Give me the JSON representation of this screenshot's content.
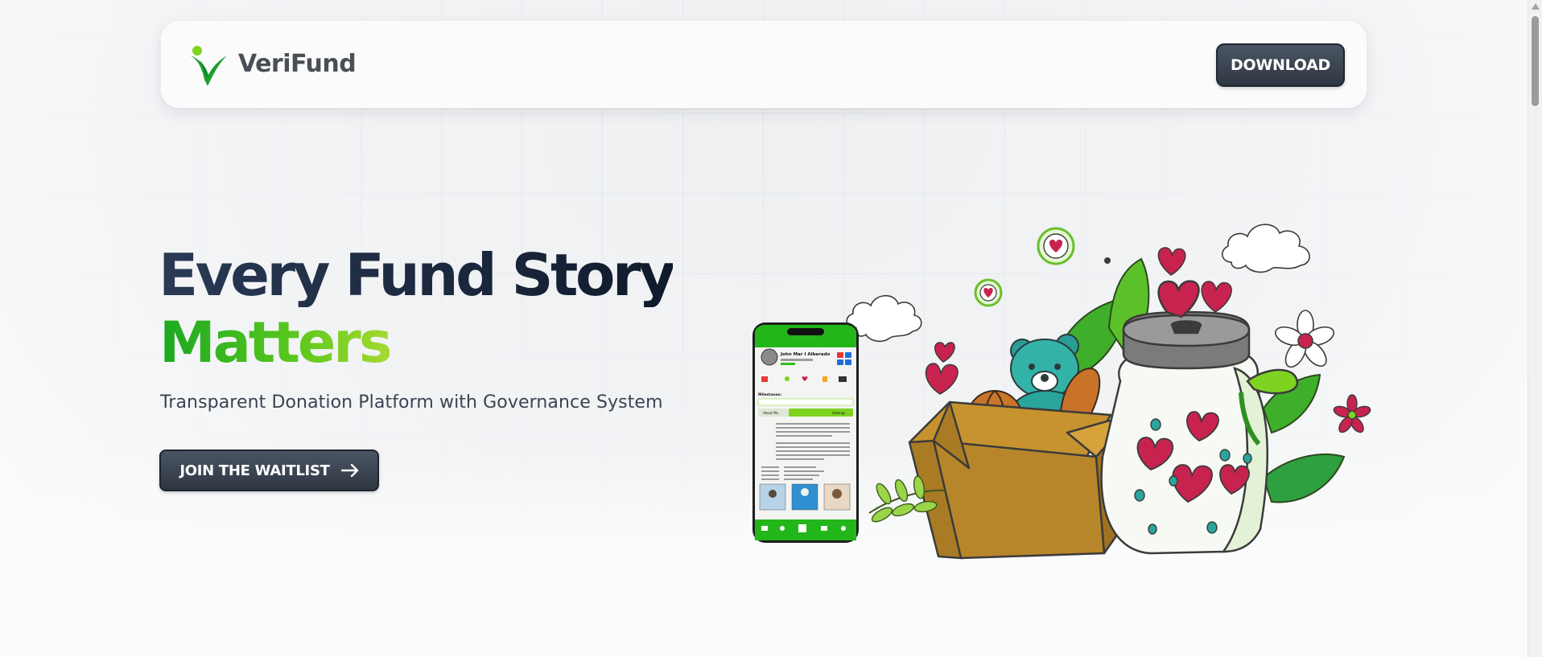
{
  "brand": {
    "name": "VeriFund",
    "accent_green": "#2fbf1e",
    "light_green": "#a6d930",
    "navy": "#1b2940"
  },
  "header": {
    "download_label": "DOWNLOAD"
  },
  "hero": {
    "title_line1": "Every Fund Story",
    "title_line2": "Matters",
    "subtitle": "Transparent Donation Platform with Governance System",
    "cta_label": "JOIN THE WAITLIST"
  },
  "phone_mockup": {
    "profile_name": "John Mar I Alberado",
    "milestones_label": "Milestones:",
    "about_tab": "About Me",
    "settings_tab": "Settings"
  },
  "icons": [
    "logo-icon",
    "arrow-right-icon",
    "heart-icon",
    "flower-icon",
    "cloud-icon"
  ]
}
